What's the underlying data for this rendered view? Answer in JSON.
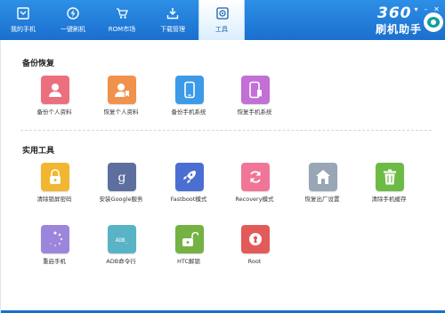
{
  "nav": {
    "my_phone": "我的手机",
    "one_click_flash": "一键刷机",
    "rom_market": "ROM市场",
    "download_mgr": "下载管理",
    "tools": "工具"
  },
  "brand": {
    "number": "360",
    "name": "刷机助手"
  },
  "backup": {
    "title": "备份恢复",
    "items": [
      "备份个人资料",
      "恢复个人资料",
      "备份手机系统",
      "恢复手机系统"
    ]
  },
  "utilities": {
    "title": "实用工具",
    "items": [
      "清除锁屏密码",
      "安装Google服务",
      "Fastboot模式",
      "Recovery模式",
      "恢复出厂设置",
      "清除手机缓存",
      "重启手机",
      "ADB命令行",
      "HTC解锁",
      "Root"
    ],
    "adb_glyph": "ADB_",
    "google_glyph": "g"
  },
  "colors": {
    "header": "#2384e0",
    "pink": "#ec6f80",
    "orange": "#f0914c",
    "blue": "#3c9be8",
    "purple": "#c26fd6",
    "yellow": "#f2b630",
    "slate": "#5d6f9e",
    "indigo": "#4b6ed3",
    "rose": "#f07597",
    "gray": "#98a6b5",
    "green": "#6cbb45",
    "lavender": "#9c86db",
    "teal": "#57b3c5",
    "lime": "#74b243",
    "red": "#e25b58"
  }
}
